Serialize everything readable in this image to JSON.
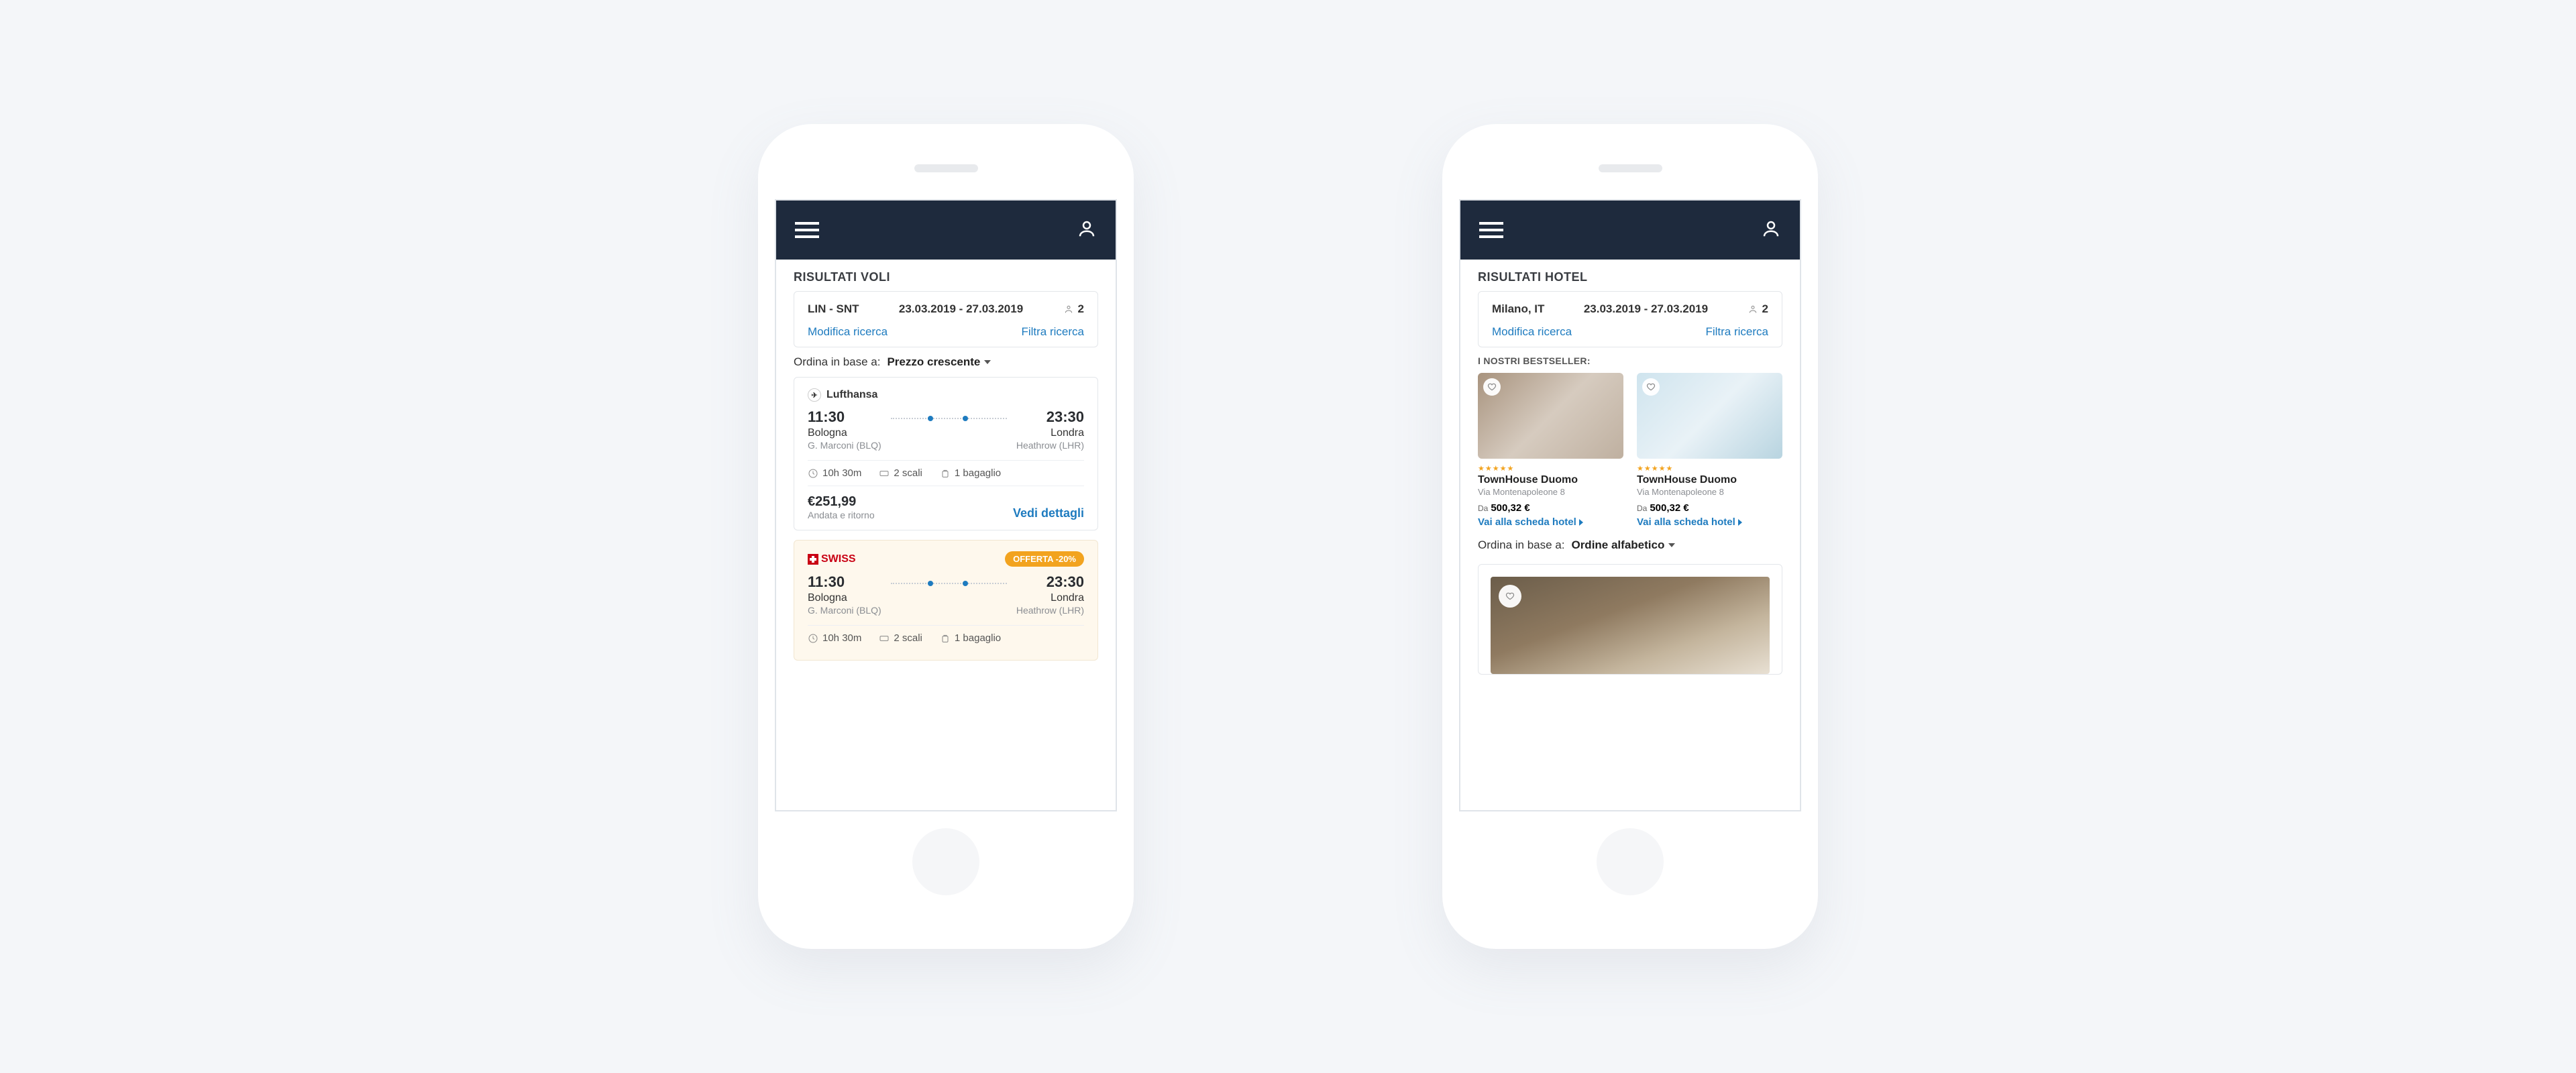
{
  "flights": {
    "title": "RISULTATI VOLI",
    "summary": {
      "route": "LIN - SNT",
      "dates": "23.03.2019 - 27.03.2019",
      "guests": "2",
      "modify": "Modifica ricerca",
      "filter": "Filtra ricerca"
    },
    "sort": {
      "label": "Ordina in base a:",
      "value": "Prezzo crescente"
    },
    "cards": [
      {
        "airline": "Lufthansa",
        "dep": {
          "time": "11:30",
          "city": "Bologna",
          "code": "G. Marconi (BLQ)"
        },
        "arr": {
          "time": "23:30",
          "city": "Londra",
          "code": "Heathrow (LHR)"
        },
        "duration": "10h 30m",
        "stops": "2 scali",
        "baggage": "1 bagaglio",
        "price": "€251,99",
        "priceSub": "Andata e ritorno",
        "details": "Vedi dettagli"
      },
      {
        "airline": "SWISS",
        "offer": "OFFERTA -20%",
        "dep": {
          "time": "11:30",
          "city": "Bologna",
          "code": "G. Marconi (BLQ)"
        },
        "arr": {
          "time": "23:30",
          "city": "Londra",
          "code": "Heathrow (LHR)"
        },
        "duration": "10h 30m",
        "stops": "2 scali",
        "baggage": "1 bagaglio"
      }
    ]
  },
  "hotels": {
    "title": "RISULTATI HOTEL",
    "summary": {
      "city": "Milano, IT",
      "dates": "23.03.2019 - 27.03.2019",
      "guests": "2",
      "modify": "Modifica ricerca",
      "filter": "Filtra ricerca"
    },
    "bestLabel": "I NOSTRI BESTSELLER:",
    "cards": [
      {
        "stars": "★★★★★",
        "name": "TownHouse Duomo",
        "addr": "Via Montenapoleone 8",
        "from": "Da",
        "price": "500,32 €",
        "link": "Vai alla scheda hotel"
      },
      {
        "stars": "★★★★★",
        "name": "TownHouse Duomo",
        "addr": "Via Montenapoleone 8",
        "from": "Da",
        "price": "500,32 €",
        "link": "Vai alla scheda hotel"
      }
    ],
    "sort": {
      "label": "Ordina in base a:",
      "value": "Ordine alfabetico"
    }
  }
}
